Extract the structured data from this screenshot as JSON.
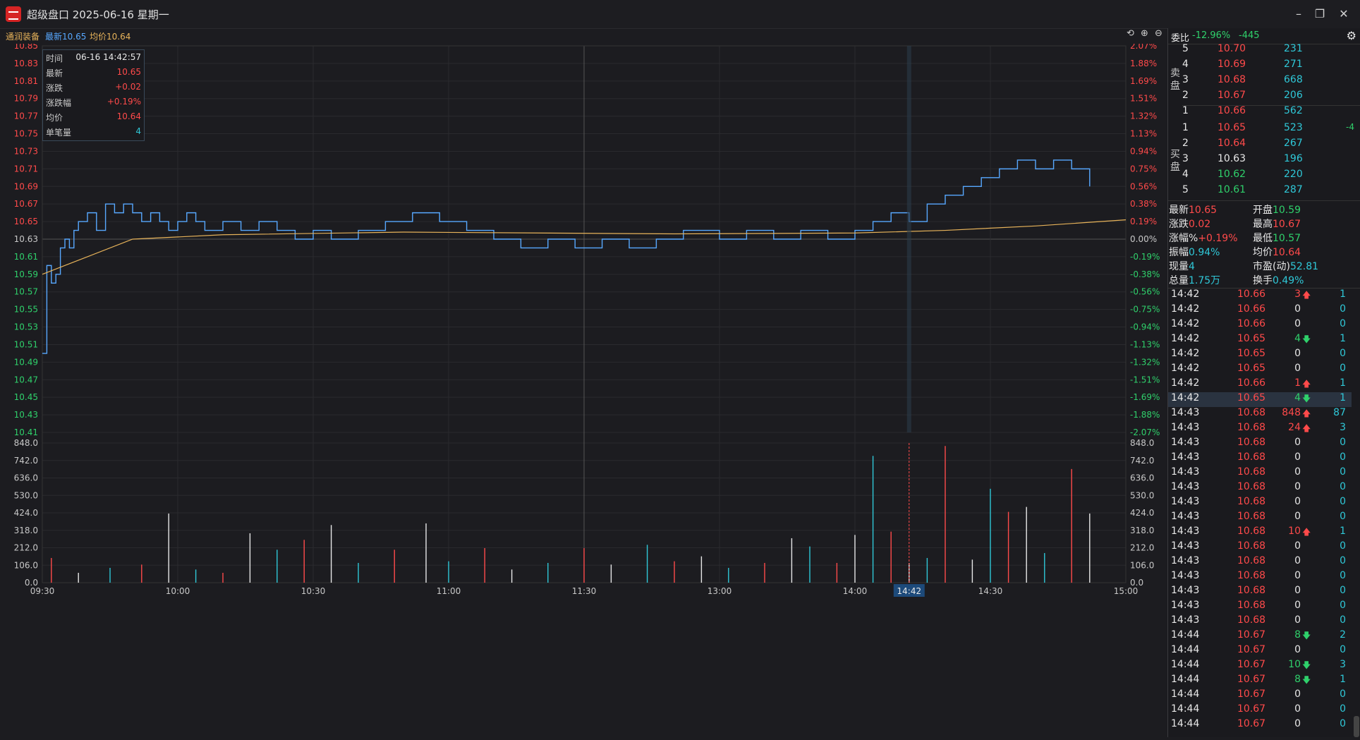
{
  "window": {
    "title": "超级盘口 2025-06-16 星期一",
    "buttons": {
      "minimize": "–",
      "restore": "❐",
      "close": "✕"
    }
  },
  "subbar": {
    "stock_name": "通润装备",
    "latest": "最新10.65",
    "avg": "均价10.64"
  },
  "tooltip": {
    "rows": [
      {
        "k": "时间",
        "v": "06-16 14:42:57",
        "c": "wt"
      },
      {
        "k": "最新",
        "v": "10.65",
        "c": "up"
      },
      {
        "k": "涨跌",
        "v": "+0.02",
        "c": "up"
      },
      {
        "k": "涨跌幅",
        "v": "+0.19%",
        "c": "up"
      },
      {
        "k": "均价",
        "v": "10.64",
        "c": "up"
      },
      {
        "k": "单笔量",
        "v": "4",
        "c": "cy"
      }
    ]
  },
  "orderbook": {
    "ratio_label": "委比",
    "ratio_pct": "-12.96%",
    "ratio_diff": "-445",
    "sell_label": [
      "卖",
      "盘"
    ],
    "buy_label": [
      "买",
      "盘"
    ],
    "sell": [
      {
        "lvl": "5",
        "price": "10.70",
        "vol": "231",
        "pc": "up"
      },
      {
        "lvl": "4",
        "price": "10.69",
        "vol": "271",
        "pc": "up"
      },
      {
        "lvl": "3",
        "price": "10.68",
        "vol": "668",
        "pc": "up"
      },
      {
        "lvl": "2",
        "price": "10.67",
        "vol": "206",
        "pc": "up"
      },
      {
        "lvl": "1",
        "price": "10.66",
        "vol": "562",
        "pc": "up"
      }
    ],
    "buy": [
      {
        "lvl": "1",
        "price": "10.65",
        "vol": "523",
        "pc": "up",
        "extra": "-4"
      },
      {
        "lvl": "2",
        "price": "10.64",
        "vol": "267",
        "pc": "up",
        "extra": ""
      },
      {
        "lvl": "3",
        "price": "10.63",
        "vol": "196",
        "pc": "wt",
        "extra": ""
      },
      {
        "lvl": "4",
        "price": "10.62",
        "vol": "220",
        "pc": "dn",
        "extra": ""
      },
      {
        "lvl": "5",
        "price": "10.61",
        "vol": "287",
        "pc": "dn",
        "extra": ""
      }
    ]
  },
  "stats": [
    {
      "k": "最新",
      "v": "10.65",
      "c": "up",
      "col": 0
    },
    {
      "k": "开盘",
      "v": "10.59",
      "c": "dn",
      "col": 1
    },
    {
      "k": "涨跌",
      "v": "0.02",
      "c": "up",
      "col": 0
    },
    {
      "k": "最高",
      "v": "10.67",
      "c": "up",
      "col": 1
    },
    {
      "k": "涨幅%",
      "v": "+0.19%",
      "c": "up",
      "col": 0
    },
    {
      "k": "最低",
      "v": "10.57",
      "c": "dn",
      "col": 1
    },
    {
      "k": "振幅",
      "v": "0.94%",
      "c": "cy",
      "col": 0
    },
    {
      "k": "均价",
      "v": "10.64",
      "c": "up",
      "col": 1
    },
    {
      "k": "现量",
      "v": "4",
      "c": "cy",
      "col": 0
    },
    {
      "k": "市盈(动)",
      "v": "52.81",
      "c": "cy",
      "col": 1
    },
    {
      "k": "总量",
      "v": "1.75万",
      "c": "cy",
      "col": 0
    },
    {
      "k": "换手",
      "v": "0.49%",
      "c": "cy",
      "col": 1
    }
  ],
  "ticks": [
    {
      "t": "14:42",
      "p": "10.66",
      "v": "3",
      "d": "up",
      "n": "1"
    },
    {
      "t": "14:42",
      "p": "10.66",
      "v": "0",
      "d": "",
      "n": "0"
    },
    {
      "t": "14:42",
      "p": "10.66",
      "v": "0",
      "d": "",
      "n": "0"
    },
    {
      "t": "14:42",
      "p": "10.65",
      "v": "4",
      "d": "dn",
      "n": "1"
    },
    {
      "t": "14:42",
      "p": "10.65",
      "v": "0",
      "d": "",
      "n": "0"
    },
    {
      "t": "14:42",
      "p": "10.65",
      "v": "0",
      "d": "",
      "n": "0"
    },
    {
      "t": "14:42",
      "p": "10.66",
      "v": "1",
      "d": "up",
      "n": "1"
    },
    {
      "t": "14:42",
      "p": "10.65",
      "v": "4",
      "d": "dn",
      "n": "1",
      "hl": true
    },
    {
      "t": "14:43",
      "p": "10.68",
      "v": "848",
      "d": "up",
      "n": "87"
    },
    {
      "t": "14:43",
      "p": "10.68",
      "v": "24",
      "d": "up",
      "n": "3"
    },
    {
      "t": "14:43",
      "p": "10.68",
      "v": "0",
      "d": "",
      "n": "0"
    },
    {
      "t": "14:43",
      "p": "10.68",
      "v": "0",
      "d": "",
      "n": "0"
    },
    {
      "t": "14:43",
      "p": "10.68",
      "v": "0",
      "d": "",
      "n": "0"
    },
    {
      "t": "14:43",
      "p": "10.68",
      "v": "0",
      "d": "",
      "n": "0"
    },
    {
      "t": "14:43",
      "p": "10.68",
      "v": "0",
      "d": "",
      "n": "0"
    },
    {
      "t": "14:43",
      "p": "10.68",
      "v": "0",
      "d": "",
      "n": "0"
    },
    {
      "t": "14:43",
      "p": "10.68",
      "v": "10",
      "d": "up",
      "n": "1"
    },
    {
      "t": "14:43",
      "p": "10.68",
      "v": "0",
      "d": "",
      "n": "0"
    },
    {
      "t": "14:43",
      "p": "10.68",
      "v": "0",
      "d": "",
      "n": "0"
    },
    {
      "t": "14:43",
      "p": "10.68",
      "v": "0",
      "d": "",
      "n": "0"
    },
    {
      "t": "14:43",
      "p": "10.68",
      "v": "0",
      "d": "",
      "n": "0"
    },
    {
      "t": "14:43",
      "p": "10.68",
      "v": "0",
      "d": "",
      "n": "0"
    },
    {
      "t": "14:43",
      "p": "10.68",
      "v": "0",
      "d": "",
      "n": "0"
    },
    {
      "t": "14:44",
      "p": "10.67",
      "v": "8",
      "d": "dn",
      "n": "2"
    },
    {
      "t": "14:44",
      "p": "10.67",
      "v": "0",
      "d": "",
      "n": "0"
    },
    {
      "t": "14:44",
      "p": "10.67",
      "v": "10",
      "d": "dn",
      "n": "3"
    },
    {
      "t": "14:44",
      "p": "10.67",
      "v": "8",
      "d": "dn",
      "n": "1"
    },
    {
      "t": "14:44",
      "p": "10.67",
      "v": "0",
      "d": "",
      "n": "0"
    },
    {
      "t": "14:44",
      "p": "10.67",
      "v": "0",
      "d": "",
      "n": "0"
    },
    {
      "t": "14:44",
      "p": "10.67",
      "v": "0",
      "d": "",
      "n": "0"
    }
  ],
  "chart_data": {
    "type": "line",
    "prev_close": 10.63,
    "price_axis": {
      "ticks": [
        "10.85",
        "10.83",
        "10.81",
        "10.79",
        "10.77",
        "10.75",
        "10.73",
        "10.71",
        "10.69",
        "10.67",
        "10.65",
        "10.63",
        "10.61",
        "10.59",
        "10.57",
        "10.55",
        "10.53",
        "10.51",
        "10.49",
        "10.47",
        "10.45",
        "10.43",
        "10.41"
      ],
      "pct_ticks": [
        "2.07%",
        "1.88%",
        "1.69%",
        "1.51%",
        "1.32%",
        "1.13%",
        "0.94%",
        "0.75%",
        "0.56%",
        "0.38%",
        "0.19%",
        "0.00%",
        "-0.19%",
        "-0.38%",
        "-0.56%",
        "-0.75%",
        "-0.94%",
        "-1.13%",
        "-1.32%",
        "-1.51%",
        "-1.69%",
        "-1.88%",
        "-2.07%"
      ],
      "ylim": [
        10.41,
        10.85
      ]
    },
    "volume_axis": {
      "ticks": [
        "848.0",
        "742.0",
        "636.0",
        "530.0",
        "424.0",
        "318.0",
        "212.0",
        "106.0",
        "0.0"
      ],
      "ylim": [
        0,
        848
      ]
    },
    "time_labels": [
      "09:30",
      "10:00",
      "10:30",
      "11:00",
      "11:30",
      "13:00",
      "14:00",
      "14:30",
      "15:00"
    ],
    "cursor_label": "14:42",
    "cursor_minute": 192,
    "price": [
      [
        0,
        10.5
      ],
      [
        1,
        10.6
      ],
      [
        2,
        10.58
      ],
      [
        3,
        10.59
      ],
      [
        4,
        10.62
      ],
      [
        5,
        10.63
      ],
      [
        6,
        10.62
      ],
      [
        7,
        10.64
      ],
      [
        8,
        10.65
      ],
      [
        10,
        10.66
      ],
      [
        12,
        10.64
      ],
      [
        14,
        10.67
      ],
      [
        16,
        10.66
      ],
      [
        18,
        10.67
      ],
      [
        20,
        10.66
      ],
      [
        22,
        10.65
      ],
      [
        24,
        10.66
      ],
      [
        26,
        10.65
      ],
      [
        28,
        10.64
      ],
      [
        30,
        10.65
      ],
      [
        32,
        10.66
      ],
      [
        34,
        10.65
      ],
      [
        36,
        10.64
      ],
      [
        40,
        10.65
      ],
      [
        44,
        10.64
      ],
      [
        48,
        10.65
      ],
      [
        52,
        10.64
      ],
      [
        56,
        10.63
      ],
      [
        60,
        10.64
      ],
      [
        64,
        10.63
      ],
      [
        70,
        10.64
      ],
      [
        76,
        10.65
      ],
      [
        82,
        10.66
      ],
      [
        88,
        10.65
      ],
      [
        94,
        10.64
      ],
      [
        100,
        10.63
      ],
      [
        106,
        10.62
      ],
      [
        112,
        10.63
      ],
      [
        118,
        10.62
      ],
      [
        124,
        10.63
      ],
      [
        130,
        10.62
      ],
      [
        136,
        10.63
      ],
      [
        142,
        10.64
      ],
      [
        150,
        10.63
      ],
      [
        156,
        10.64
      ],
      [
        162,
        10.63
      ],
      [
        168,
        10.64
      ],
      [
        174,
        10.63
      ],
      [
        180,
        10.64
      ],
      [
        184,
        10.65
      ],
      [
        188,
        10.66
      ],
      [
        192,
        10.65
      ],
      [
        196,
        10.67
      ],
      [
        200,
        10.68
      ],
      [
        204,
        10.69
      ],
      [
        208,
        10.7
      ],
      [
        212,
        10.71
      ],
      [
        216,
        10.72
      ],
      [
        220,
        10.71
      ],
      [
        224,
        10.72
      ],
      [
        228,
        10.71
      ],
      [
        232,
        10.69
      ]
    ],
    "avg": [
      [
        0,
        10.59
      ],
      [
        5,
        10.6
      ],
      [
        10,
        10.61
      ],
      [
        20,
        10.63
      ],
      [
        40,
        10.635
      ],
      [
        80,
        10.638
      ],
      [
        140,
        10.636
      ],
      [
        180,
        10.637
      ],
      [
        200,
        10.64
      ],
      [
        220,
        10.645
      ],
      [
        240,
        10.652
      ]
    ],
    "volume": [
      [
        2,
        150
      ],
      [
        8,
        60
      ],
      [
        15,
        90
      ],
      [
        22,
        110
      ],
      [
        28,
        420
      ],
      [
        34,
        80
      ],
      [
        40,
        60
      ],
      [
        46,
        300
      ],
      [
        52,
        200
      ],
      [
        58,
        260
      ],
      [
        64,
        350
      ],
      [
        70,
        120
      ],
      [
        78,
        200
      ],
      [
        85,
        360
      ],
      [
        90,
        130
      ],
      [
        98,
        210
      ],
      [
        104,
        80
      ],
      [
        112,
        120
      ],
      [
        120,
        210
      ],
      [
        126,
        110
      ],
      [
        134,
        230
      ],
      [
        140,
        130
      ],
      [
        146,
        160
      ],
      [
        152,
        90
      ],
      [
        160,
        120
      ],
      [
        166,
        270
      ],
      [
        170,
        220
      ],
      [
        176,
        120
      ],
      [
        180,
        290
      ],
      [
        184,
        770
      ],
      [
        188,
        310
      ],
      [
        192,
        120
      ],
      [
        196,
        150
      ],
      [
        200,
        830
      ],
      [
        206,
        140
      ],
      [
        210,
        570
      ],
      [
        214,
        430
      ],
      [
        218,
        460
      ],
      [
        222,
        180
      ],
      [
        228,
        690
      ],
      [
        232,
        420
      ]
    ]
  }
}
